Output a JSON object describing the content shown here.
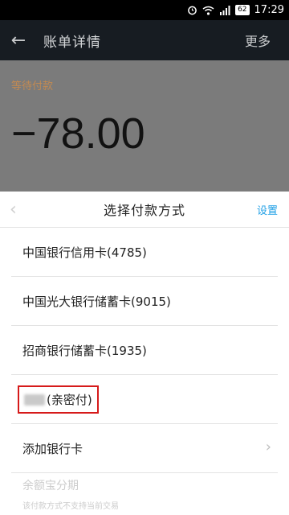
{
  "status_bar": {
    "time": "17:29",
    "battery": "62",
    "icons": [
      "alarm-icon",
      "wifi-icon",
      "signal-icon",
      "battery-icon"
    ]
  },
  "app_bar": {
    "title": "账单详情",
    "more_label": "更多"
  },
  "bill": {
    "status": "等待付款",
    "amount": "−78.00"
  },
  "payment_sheet": {
    "title": "选择付款方式",
    "settings_label": "设置",
    "options": [
      {
        "label": "中国银行信用卡(4785)"
      },
      {
        "label": "中国光大银行储蓄卡(9015)"
      },
      {
        "label": "招商银行储蓄卡(1935)"
      },
      {
        "label": "(亲密付)"
      },
      {
        "label": "添加银行卡"
      }
    ],
    "disabled_option": {
      "label": "余额宝分期",
      "note": "该付款方式不支持当前交易"
    }
  },
  "colors": {
    "accent": "#1e9fe6",
    "highlight_box": "#d61a1a",
    "status_text": "#c28a52"
  }
}
